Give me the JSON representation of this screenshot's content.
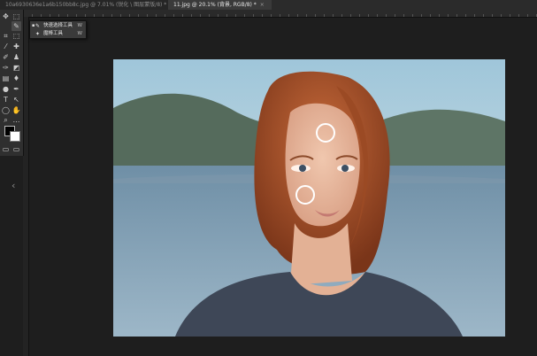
{
  "tabs": [
    {
      "label": "10a6930636e1a6b150bb8c.jpg @ 7.01% (锐化 \\ 图层蒙版/8) *",
      "close": "×"
    },
    {
      "label": "11.jpg @ 20.1% (背景, RGB/8) *",
      "close": "×"
    }
  ],
  "tools": [
    {
      "icon": "move-icon",
      "glyph": "✥"
    },
    {
      "icon": "marquee-icon",
      "glyph": "⬚"
    },
    {
      "icon": "quick-select-icon",
      "glyph": "✎"
    },
    {
      "icon": "crop-icon",
      "glyph": "⌗"
    },
    {
      "icon": "eyedropper-icon",
      "glyph": "⁄"
    },
    {
      "icon": "healing-icon",
      "glyph": "✚"
    },
    {
      "icon": "brush-icon",
      "glyph": "✐"
    },
    {
      "icon": "history-brush-icon",
      "glyph": "✑"
    },
    {
      "icon": "gradient-icon",
      "glyph": "▤"
    },
    {
      "icon": "dodge-icon",
      "glyph": "●"
    },
    {
      "icon": "type-icon",
      "glyph": "T"
    },
    {
      "icon": "ellipse-icon",
      "glyph": "◯"
    },
    {
      "icon": "zoom-icon",
      "glyph": "⌕"
    },
    {
      "icon": "pen-icon",
      "glyph": "✒"
    },
    {
      "icon": "path-select-icon",
      "glyph": "↖"
    },
    {
      "icon": "stamp-icon",
      "glyph": "♟"
    },
    {
      "icon": "eraser-icon",
      "glyph": "◩"
    },
    {
      "icon": "blur-icon",
      "glyph": "♦"
    },
    {
      "icon": "shape-icon",
      "glyph": "▭"
    },
    {
      "icon": "hand-icon",
      "glyph": "✋"
    },
    {
      "icon": "more-icon",
      "glyph": "…"
    }
  ],
  "flyout": {
    "items": [
      {
        "marker": "▪",
        "icon": "quick-select-icon",
        "glyph": "✎",
        "label": "快速选择工具",
        "shortcut": "W"
      },
      {
        "marker": "",
        "icon": "magic-wand-icon",
        "glyph": "✦",
        "label": "魔棒工具",
        "shortcut": "W"
      }
    ]
  },
  "panel_collapse": "‹",
  "colors": {
    "foreground": "#000000",
    "background": "#ffffff"
  }
}
